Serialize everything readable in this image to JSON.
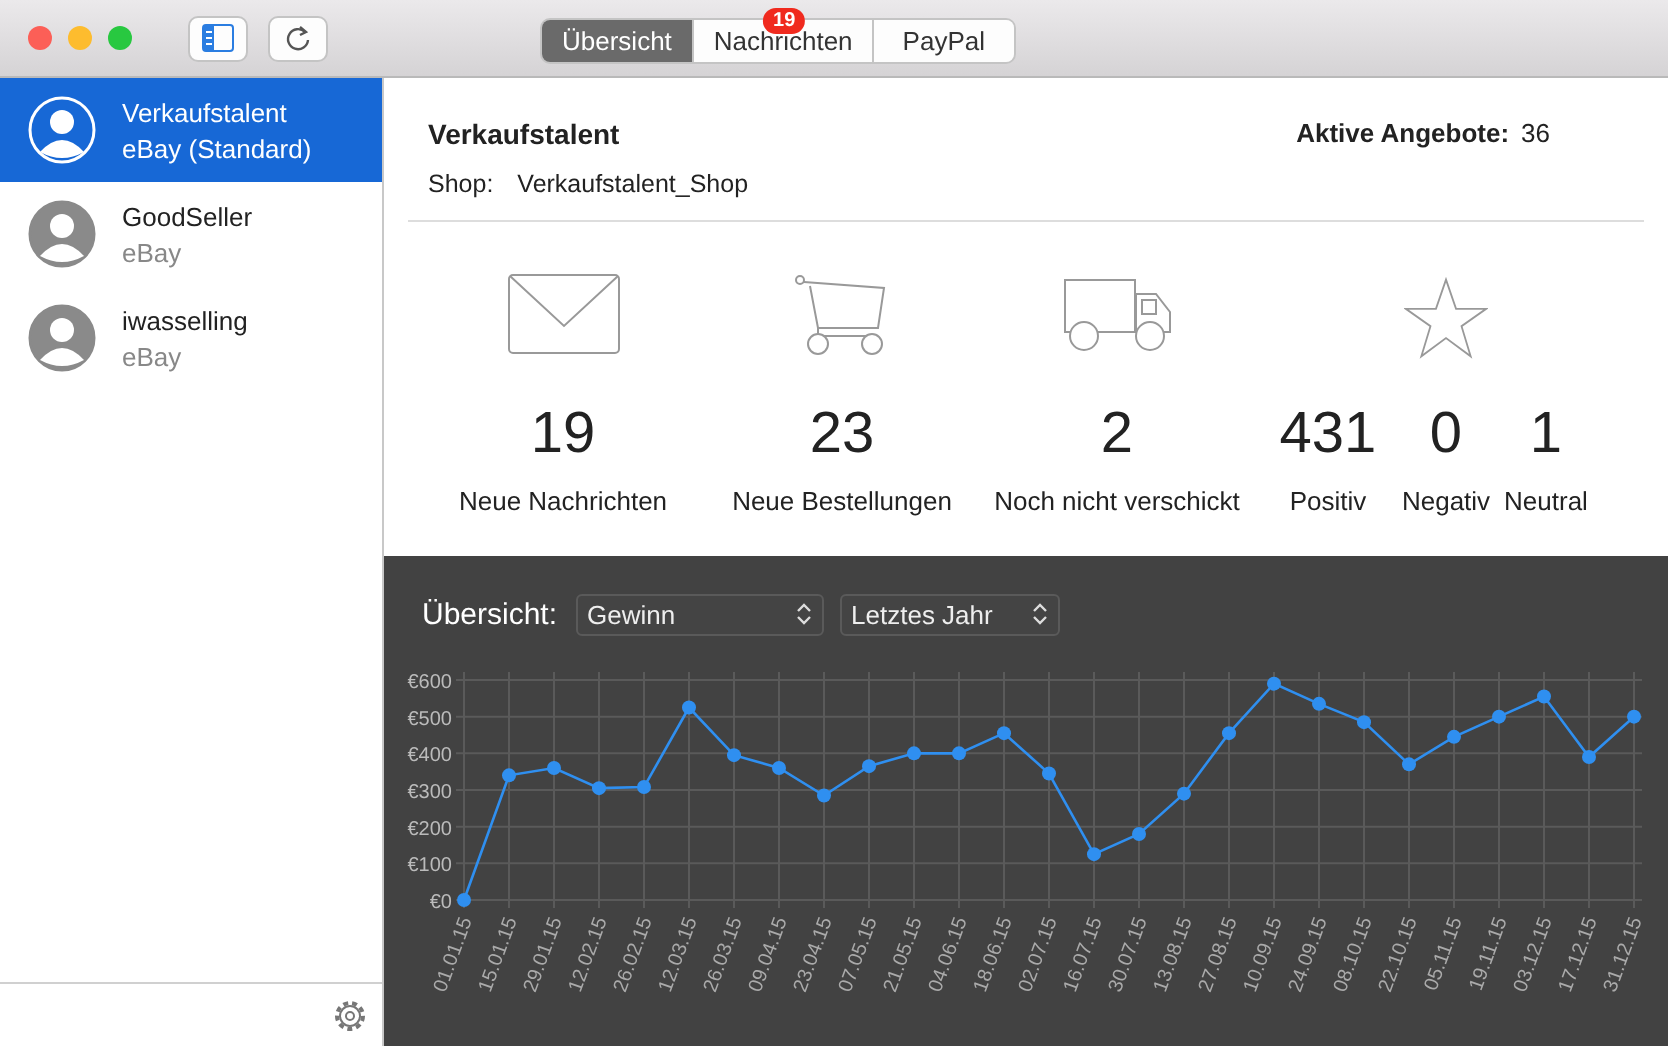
{
  "toolbar": {
    "segments": [
      {
        "label": "Übersicht",
        "selected": true
      },
      {
        "label": "Nachrichten",
        "selected": false,
        "badge": "19"
      },
      {
        "label": "PayPal",
        "selected": false
      }
    ]
  },
  "sidebar": {
    "accounts": [
      {
        "name": "Verkaufstalent",
        "platform": "eBay (Standard)",
        "selected": true
      },
      {
        "name": "GoodSeller",
        "platform": "eBay",
        "selected": false
      },
      {
        "name": "iwasselling",
        "platform": "eBay",
        "selected": false
      }
    ]
  },
  "header": {
    "title": "Verkaufstalent",
    "active_label": "Aktive Angebote:",
    "active_value": "36",
    "shop_label": "Shop:",
    "shop_value": "Verkaufstalent_Shop"
  },
  "stats": [
    {
      "kind": "messages",
      "value": "19",
      "label": "Neue Nachrichten"
    },
    {
      "kind": "orders",
      "value": "23",
      "label": "Neue Bestellungen"
    },
    {
      "kind": "shipping",
      "value": "2",
      "label": "Noch nicht verschickt"
    },
    {
      "kind": "rating",
      "value": "431",
      "label": "Positiv"
    },
    {
      "kind": "rating_main",
      "value": "0",
      "label": "Negativ"
    },
    {
      "kind": "rating",
      "value": "1",
      "label": "Neutral"
    }
  ],
  "overview": {
    "label": "Übersicht:",
    "metric": "Gewinn",
    "period": "Letztes Jahr",
    "chart_data": {
      "type": "line",
      "categories": [
        "01.01.15",
        "15.01.15",
        "29.01.15",
        "12.02.15",
        "26.02.15",
        "12.03.15",
        "26.03.15",
        "09.04.15",
        "23.04.15",
        "07.05.15",
        "21.05.15",
        "04.06.15",
        "18.06.15",
        "02.07.15",
        "16.07.15",
        "30.07.15",
        "13.08.15",
        "27.08.15",
        "10.09.15",
        "24.09.15",
        "08.10.15",
        "22.10.15",
        "05.11.15",
        "19.11.15",
        "03.12.15",
        "17.12.15",
        "31.12.15"
      ],
      "grid": true,
      "series": [
        {
          "color": "#2f8ff0",
          "marker": "circle",
          "values": [
            0,
            340,
            360,
            305,
            308,
            525,
            395,
            360,
            285,
            365,
            400,
            400,
            455,
            345,
            125,
            180,
            290,
            455,
            590,
            535,
            485,
            370,
            445,
            500,
            555,
            390,
            500
          ]
        }
      ],
      "ylim": [
        0,
        600
      ],
      "yticks": [
        {
          "value": 0,
          "label": "€0"
        },
        {
          "value": 100,
          "label": "€100"
        },
        {
          "value": 200,
          "label": "€200"
        },
        {
          "value": 300,
          "label": "€300"
        },
        {
          "value": 400,
          "label": "€400"
        },
        {
          "value": 500,
          "label": "€500"
        },
        {
          "value": 600,
          "label": "€600"
        }
      ]
    }
  }
}
